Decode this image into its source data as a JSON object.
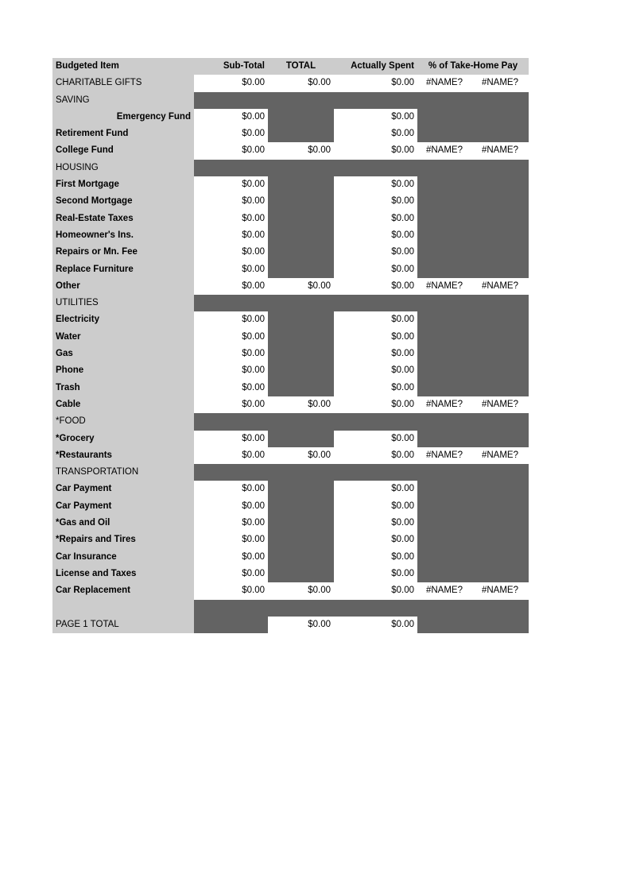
{
  "sheet": {
    "columns": [
      {
        "key": "label",
        "header": "Budgeted Item",
        "align": "left"
      },
      {
        "key": "subtotal",
        "header": "Sub-Total",
        "align": "right"
      },
      {
        "key": "total",
        "header": "TOTAL",
        "align": "center"
      },
      {
        "key": "spent",
        "header": "Actually Spent",
        "align": "right"
      },
      {
        "key": "pct",
        "header": "% of Take-Home Pay",
        "align": "center"
      }
    ],
    "header": {
      "budgeted_item": "Budgeted Item",
      "sub_total": "Sub-Total",
      "total": "TOTAL",
      "actually_spent": "Actually Spent",
      "pct_take_home_pay": "% of Take-Home Pay"
    },
    "values": {
      "zero": "$0.00",
      "name_error": "#NAME?",
      "blank": ""
    },
    "colors": {
      "label_fill": "#cccccc",
      "inactive_fill": "#636363",
      "active_fill": "#ffffff",
      "text": "#000000"
    },
    "rows": [
      {
        "label": "CHARITABLE GIFTS",
        "kind": "category-total",
        "subtotal": "$0.00",
        "total": "$0.00",
        "spent": "$0.00",
        "pct_a": "#NAME?",
        "pct_b": "#NAME?"
      },
      {
        "label": "SAVING",
        "kind": "category",
        "subtotal": "",
        "total": "",
        "spent": "",
        "pct_a": "",
        "pct_b": ""
      },
      {
        "label": "Emergency Fund",
        "kind": "item-right",
        "subtotal": "$0.00",
        "total": "",
        "spent": "$0.00",
        "pct_a": "",
        "pct_b": ""
      },
      {
        "label": "Retirement Fund",
        "kind": "item",
        "subtotal": "$0.00",
        "total": "",
        "spent": "$0.00",
        "pct_a": "",
        "pct_b": ""
      },
      {
        "label": "College Fund",
        "kind": "item-total",
        "subtotal": "$0.00",
        "total": "$0.00",
        "spent": "$0.00",
        "pct_a": "#NAME?",
        "pct_b": "#NAME?"
      },
      {
        "label": "HOUSING",
        "kind": "category",
        "subtotal": "",
        "total": "",
        "spent": "",
        "pct_a": "",
        "pct_b": ""
      },
      {
        "label": "First Mortgage",
        "kind": "item",
        "subtotal": "$0.00",
        "total": "",
        "spent": "$0.00",
        "pct_a": "",
        "pct_b": ""
      },
      {
        "label": "Second Mortgage",
        "kind": "item",
        "subtotal": "$0.00",
        "total": "",
        "spent": "$0.00",
        "pct_a": "",
        "pct_b": ""
      },
      {
        "label": "Real-Estate Taxes",
        "kind": "item",
        "subtotal": "$0.00",
        "total": "",
        "spent": "$0.00",
        "pct_a": "",
        "pct_b": ""
      },
      {
        "label": "Homeowner's Ins.",
        "kind": "item",
        "subtotal": "$0.00",
        "total": "",
        "spent": "$0.00",
        "pct_a": "",
        "pct_b": ""
      },
      {
        "label": "Repairs or Mn. Fee",
        "kind": "item",
        "subtotal": "$0.00",
        "total": "",
        "spent": "$0.00",
        "pct_a": "",
        "pct_b": ""
      },
      {
        "label": "Replace Furniture",
        "kind": "item",
        "subtotal": "$0.00",
        "total": "",
        "spent": "$0.00",
        "pct_a": "",
        "pct_b": ""
      },
      {
        "label": "Other",
        "kind": "item-total",
        "subtotal": "$0.00",
        "total": "$0.00",
        "spent": "$0.00",
        "pct_a": "#NAME?",
        "pct_b": "#NAME?"
      },
      {
        "label": "UTILITIES",
        "kind": "category",
        "subtotal": "",
        "total": "",
        "spent": "",
        "pct_a": "",
        "pct_b": ""
      },
      {
        "label": "Electricity",
        "kind": "item",
        "subtotal": "$0.00",
        "total": "",
        "spent": "$0.00",
        "pct_a": "",
        "pct_b": ""
      },
      {
        "label": "Water",
        "kind": "item",
        "subtotal": "$0.00",
        "total": "",
        "spent": "$0.00",
        "pct_a": "",
        "pct_b": ""
      },
      {
        "label": "Gas",
        "kind": "item",
        "subtotal": "$0.00",
        "total": "",
        "spent": "$0.00",
        "pct_a": "",
        "pct_b": ""
      },
      {
        "label": "Phone",
        "kind": "item",
        "subtotal": "$0.00",
        "total": "",
        "spent": "$0.00",
        "pct_a": "",
        "pct_b": ""
      },
      {
        "label": "Trash",
        "kind": "item",
        "subtotal": "$0.00",
        "total": "",
        "spent": "$0.00",
        "pct_a": "",
        "pct_b": ""
      },
      {
        "label": "Cable",
        "kind": "item-total",
        "subtotal": "$0.00",
        "total": "$0.00",
        "spent": "$0.00",
        "pct_a": "#NAME?",
        "pct_b": "#NAME?"
      },
      {
        "label": "*FOOD",
        "kind": "category",
        "subtotal": "",
        "total": "",
        "spent": "",
        "pct_a": "",
        "pct_b": ""
      },
      {
        "label": "*Grocery",
        "kind": "item",
        "subtotal": "$0.00",
        "total": "",
        "spent": "$0.00",
        "pct_a": "",
        "pct_b": ""
      },
      {
        "label": "*Restaurants",
        "kind": "item-total",
        "subtotal": "$0.00",
        "total": "$0.00",
        "spent": "$0.00",
        "pct_a": "#NAME?",
        "pct_b": "#NAME?"
      },
      {
        "label": "TRANSPORTATION",
        "kind": "category",
        "subtotal": "",
        "total": "",
        "spent": "",
        "pct_a": "",
        "pct_b": ""
      },
      {
        "label": "Car Payment",
        "kind": "item",
        "subtotal": "$0.00",
        "total": "",
        "spent": "$0.00",
        "pct_a": "",
        "pct_b": ""
      },
      {
        "label": "Car Payment",
        "kind": "item",
        "subtotal": "$0.00",
        "total": "",
        "spent": "$0.00",
        "pct_a": "",
        "pct_b": ""
      },
      {
        "label": "*Gas and Oil",
        "kind": "item",
        "subtotal": "$0.00",
        "total": "",
        "spent": "$0.00",
        "pct_a": "",
        "pct_b": ""
      },
      {
        "label": "*Repairs and Tires",
        "kind": "item",
        "subtotal": "$0.00",
        "total": "",
        "spent": "$0.00",
        "pct_a": "",
        "pct_b": ""
      },
      {
        "label": "Car Insurance",
        "kind": "item",
        "subtotal": "$0.00",
        "total": "",
        "spent": "$0.00",
        "pct_a": "",
        "pct_b": ""
      },
      {
        "label": "License and Taxes",
        "kind": "item",
        "subtotal": "$0.00",
        "total": "",
        "spent": "$0.00",
        "pct_a": "",
        "pct_b": ""
      },
      {
        "label": "Car Replacement",
        "kind": "item-total",
        "subtotal": "$0.00",
        "total": "$0.00",
        "spent": "$0.00",
        "pct_a": "#NAME?",
        "pct_b": "#NAME?"
      },
      {
        "label": "",
        "kind": "spacer",
        "subtotal": "",
        "total": "",
        "spent": "",
        "pct_a": "",
        "pct_b": ""
      },
      {
        "label": "PAGE 1 TOTAL",
        "kind": "page-total",
        "subtotal": "",
        "total": "$0.00",
        "spent": "$0.00",
        "pct_a": "",
        "pct_b": ""
      }
    ]
  }
}
